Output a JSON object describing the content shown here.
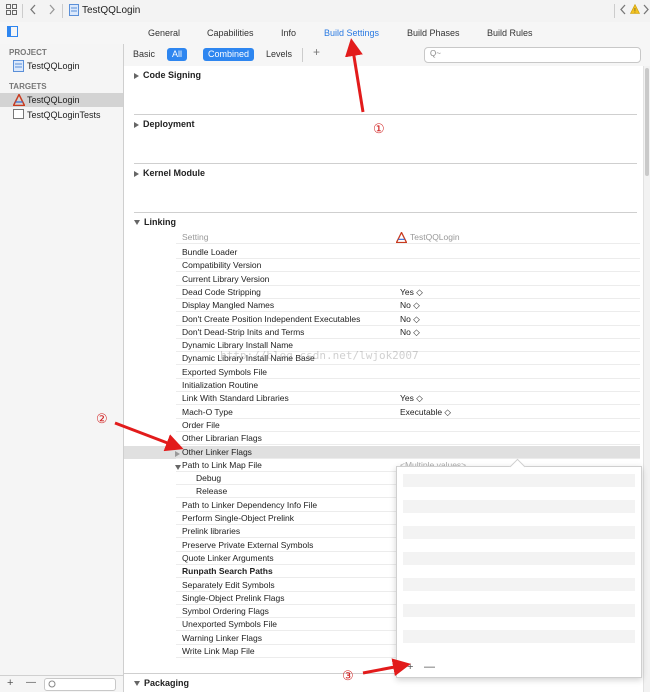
{
  "window": {
    "title": "TestQQLogin"
  },
  "tabs": [
    {
      "label": "General",
      "active": false
    },
    {
      "label": "Capabilities",
      "active": false
    },
    {
      "label": "Info",
      "active": false
    },
    {
      "label": "Build Settings",
      "active": true
    },
    {
      "label": "Build Phases",
      "active": false
    },
    {
      "label": "Build Rules",
      "active": false
    }
  ],
  "sidebar": {
    "project_header": "PROJECT",
    "project_item": "TestQQLogin",
    "targets_header": "TARGETS",
    "targets": [
      {
        "label": "TestQQLogin",
        "selected": true
      },
      {
        "label": "TestQQLoginTests",
        "selected": false
      }
    ],
    "bottom": {
      "add": "+",
      "remove": "—"
    }
  },
  "filterbar": {
    "basic": "Basic",
    "all": "All",
    "combined": "Combined",
    "levels": "Levels",
    "add": "+",
    "search_placeholder": "Q~"
  },
  "sections": {
    "code_signing": "Code Signing",
    "deployment": "Deployment",
    "kernel_module": "Kernel Module",
    "linking": "Linking",
    "packaging": "Packaging"
  },
  "linking": {
    "col_setting": "Setting",
    "col_target": "TestQQLogin",
    "rows": [
      {
        "name": "Bundle Loader",
        "value": ""
      },
      {
        "name": "Compatibility Version",
        "value": ""
      },
      {
        "name": "Current Library Version",
        "value": ""
      },
      {
        "name": "Dead Code Stripping",
        "value": "Yes ◇"
      },
      {
        "name": "Display Mangled Names",
        "value": "No ◇"
      },
      {
        "name": "Don't Create Position Independent Executables",
        "value": "No ◇"
      },
      {
        "name": "Don't Dead-Strip Inits and Terms",
        "value": "No ◇"
      },
      {
        "name": "Dynamic Library Install Name",
        "value": ""
      },
      {
        "name": "Dynamic Library Install Name Base",
        "value": ""
      },
      {
        "name": "Exported Symbols File",
        "value": ""
      },
      {
        "name": "Initialization Routine",
        "value": ""
      },
      {
        "name": "Link With Standard Libraries",
        "value": "Yes ◇"
      },
      {
        "name": "Mach-O Type",
        "value": "Executable ◇"
      },
      {
        "name": "Order File",
        "value": ""
      },
      {
        "name": "Other Librarian Flags",
        "value": ""
      },
      {
        "name": "Other Linker Flags",
        "value": ""
      },
      {
        "name": "Path to Link Map File",
        "value": "<Multiple values>"
      },
      {
        "name": "Debug",
        "value": ""
      },
      {
        "name": "Release",
        "value": ""
      },
      {
        "name": "Path to Linker Dependency Info File",
        "value": ""
      },
      {
        "name": "Perform Single-Object Prelink",
        "value": ""
      },
      {
        "name": "Prelink libraries",
        "value": ""
      },
      {
        "name": "Preserve Private External Symbols",
        "value": ""
      },
      {
        "name": "Quote Linker Arguments",
        "value": ""
      },
      {
        "name": "Runpath Search Paths",
        "value": ""
      },
      {
        "name": "Separately Edit Symbols",
        "value": ""
      },
      {
        "name": "Single-Object Prelink Flags",
        "value": ""
      },
      {
        "name": "Symbol Ordering Flags",
        "value": ""
      },
      {
        "name": "Unexported Symbols File",
        "value": ""
      },
      {
        "name": "Warning Linker Flags",
        "value": ""
      },
      {
        "name": "Write Link Map File",
        "value": ""
      }
    ]
  },
  "popover": {
    "add": "+",
    "remove": "—"
  },
  "watermark": "http://blog.csdn.net/lwjok2007",
  "annotations": {
    "one": "①",
    "two": "②",
    "three": "③"
  },
  "colors": {
    "accent": "#2e86f0",
    "arrow": "#e21b1b"
  }
}
